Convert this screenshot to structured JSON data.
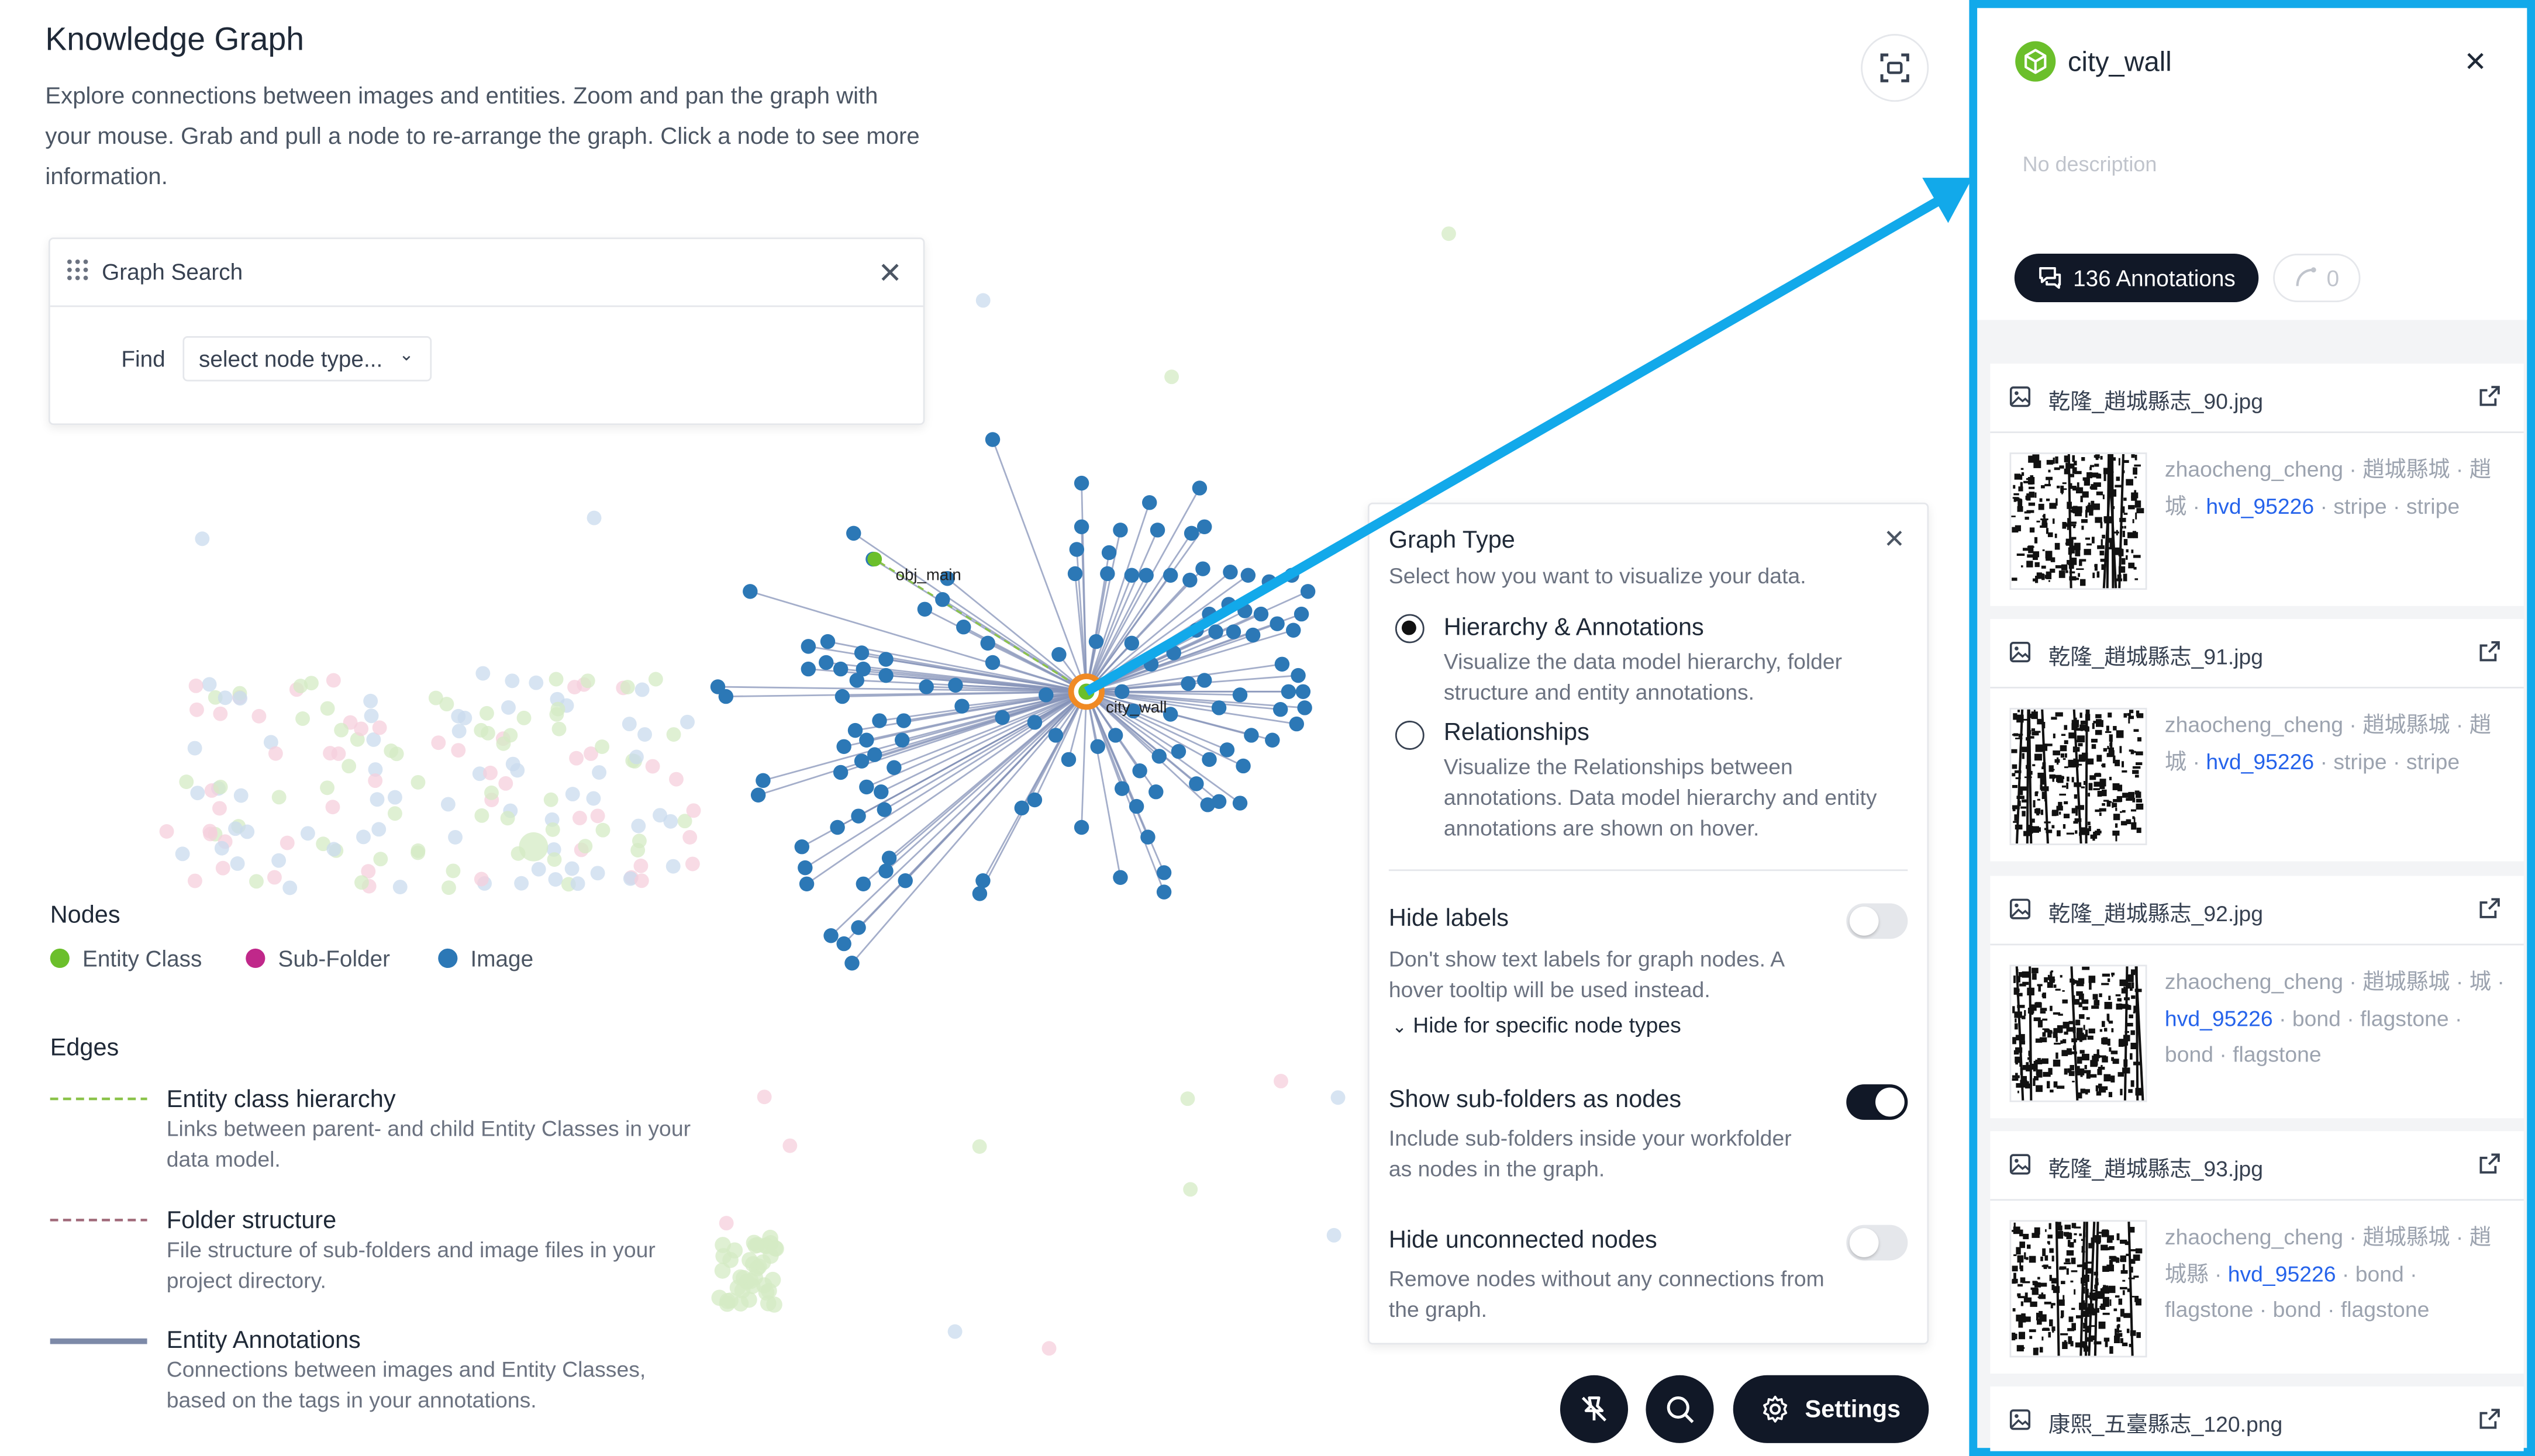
{
  "header": {
    "title": "Knowledge Graph",
    "description": "Explore connections between images and entities. Zoom and pan the graph with your mouse. Grab and pull a node to re-arrange the graph. Click a node to see more information."
  },
  "search": {
    "title": "Graph Search",
    "find_label": "Find",
    "select_placeholder": "select node type..."
  },
  "graph_labels": {
    "main_node": "city_wall",
    "secondary_node": "obj_main"
  },
  "legend": {
    "nodes_title": "Nodes",
    "nodes": [
      {
        "label": "Entity Class",
        "color": "#6bbf2b"
      },
      {
        "label": "Sub-Folder",
        "color": "#c0288a"
      },
      {
        "label": "Image",
        "color": "#2c78b6"
      }
    ],
    "edges_title": "Edges",
    "edges": [
      {
        "title": "Entity class hierarchy",
        "desc": "Links between parent- and child Entity Classes in your data model.",
        "color": "#8bc34a",
        "style": "dashed"
      },
      {
        "title": "Folder structure",
        "desc": "File structure of sub-folders and image files in your project directory.",
        "color": "#a06a7a",
        "style": "dashed"
      },
      {
        "title": "Entity Annotations",
        "desc": "Connections between images and Entity Classes, based on the tags in your annotations.",
        "color": "#7d8aa8",
        "style": "solid"
      }
    ]
  },
  "settings": {
    "graph_type_title": "Graph Type",
    "graph_type_desc": "Select how you want to visualize your data.",
    "options": [
      {
        "label": "Hierarchy & Annotations",
        "desc": "Visualize the data model hierarchy, folder structure and entity annotations.",
        "selected": true
      },
      {
        "label": "Relationships",
        "desc": "Visualize the Relationships between annotations. Data model hierarchy and entity annotations are shown on hover.",
        "selected": false
      }
    ],
    "hide_labels_title": "Hide labels",
    "hide_labels_desc": "Don't show text labels for graph nodes. A hover tooltip will be used instead.",
    "hide_labels_on": false,
    "hide_specific_label": "Hide for specific node types",
    "subfolders_title": "Show sub-folders as nodes",
    "subfolders_desc": "Include sub-folders inside your workfolder as nodes in the graph.",
    "subfolders_on": true,
    "unconnected_title": "Hide unconnected nodes",
    "unconnected_desc": "Remove nodes without any connections from the graph.",
    "unconnected_on": false
  },
  "toolbar": {
    "settings_label": "Settings"
  },
  "panel": {
    "title": "city_wall",
    "description": "No description",
    "annotations_label": "136 Annotations",
    "relations_count": "0",
    "items": [
      {
        "file": "乾隆_趙城縣志_90.jpg",
        "tags": [
          "zhaocheng_cheng",
          "趙城縣城",
          "趙城"
        ],
        "link": "hvd_95226",
        "tags2": [
          "stripe",
          "stripe"
        ]
      },
      {
        "file": "乾隆_趙城縣志_91.jpg",
        "tags": [
          "zhaocheng_cheng",
          "趙城縣城",
          "趙城"
        ],
        "link": "hvd_95226",
        "tags2": [
          "stripe",
          "stripe"
        ]
      },
      {
        "file": "乾隆_趙城縣志_92.jpg",
        "tags": [
          "zhaocheng_cheng",
          "趙城縣城",
          "城"
        ],
        "link": "hvd_95226",
        "tags2": [
          "bond",
          "flagstone",
          "bond",
          "flagstone"
        ]
      },
      {
        "file": "乾隆_趙城縣志_93.jpg",
        "tags": [
          "zhaocheng_cheng",
          "趙城縣城",
          "趙城縣"
        ],
        "link": "hvd_95226",
        "tags2": [
          "bond",
          "flagstone",
          "bond",
          "flagstone"
        ]
      },
      {
        "file": "康熙_五臺縣志_120.png"
      }
    ]
  },
  "colors": {
    "highlight": "#12a9ea",
    "image_node": "#2c78b6",
    "entity_node": "#6bbf2b",
    "edge": "#8593b8"
  }
}
